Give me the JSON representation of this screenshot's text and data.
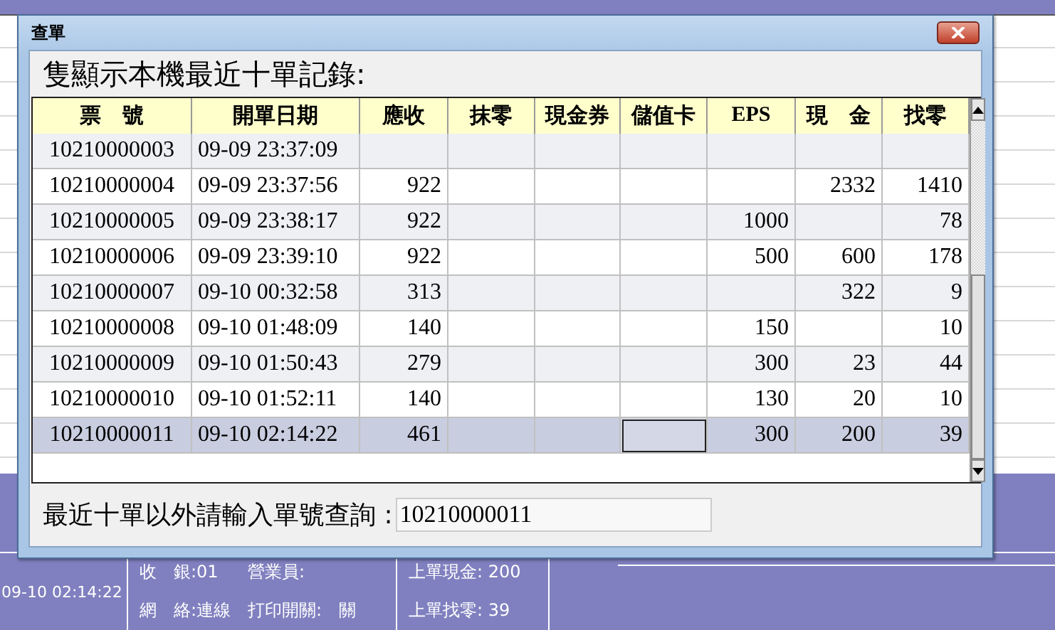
{
  "window": {
    "title": "查單"
  },
  "heading": "隻顯示本機最近十單記錄:",
  "table": {
    "columns": [
      "票　號",
      "開單日期",
      "應收",
      "抹零",
      "現金券",
      "儲值卡",
      "EPS",
      "現　金",
      "找零"
    ],
    "rows": [
      {
        "selected": false,
        "cells": [
          "10210000003",
          "09-09 23:37:09",
          null,
          null,
          null,
          null,
          null,
          null,
          null
        ],
        "focused": [
          false,
          false,
          false,
          false,
          false,
          false,
          false,
          false,
          false
        ]
      },
      {
        "selected": false,
        "cells": [
          "10210000004",
          "09-09 23:37:56",
          "922",
          null,
          null,
          null,
          null,
          "2332",
          "1410"
        ],
        "focused": [
          false,
          false,
          false,
          false,
          false,
          false,
          false,
          false,
          false
        ]
      },
      {
        "selected": false,
        "cells": [
          "10210000005",
          "09-09 23:38:17",
          "922",
          null,
          null,
          null,
          "1000",
          null,
          "78"
        ],
        "focused": [
          false,
          false,
          false,
          false,
          false,
          false,
          false,
          false,
          false
        ]
      },
      {
        "selected": false,
        "cells": [
          "10210000006",
          "09-09 23:39:10",
          "922",
          null,
          null,
          null,
          "500",
          "600",
          "178"
        ],
        "focused": [
          false,
          false,
          false,
          false,
          false,
          false,
          false,
          false,
          false
        ]
      },
      {
        "selected": false,
        "cells": [
          "10210000007",
          "09-10 00:32:58",
          "313",
          null,
          null,
          null,
          null,
          "322",
          "9"
        ],
        "focused": [
          false,
          false,
          false,
          false,
          false,
          false,
          false,
          false,
          false
        ]
      },
      {
        "selected": false,
        "cells": [
          "10210000008",
          "09-10 01:48:09",
          "140",
          null,
          null,
          null,
          "150",
          null,
          "10"
        ],
        "focused": [
          false,
          false,
          false,
          false,
          false,
          false,
          false,
          false,
          false
        ]
      },
      {
        "selected": false,
        "cells": [
          "10210000009",
          "09-10 01:50:43",
          "279",
          null,
          null,
          null,
          "300",
          "23",
          "44"
        ],
        "focused": [
          false,
          false,
          false,
          false,
          false,
          false,
          false,
          false,
          false
        ]
      },
      {
        "selected": false,
        "cells": [
          "10210000010",
          "09-10 01:52:11",
          "140",
          null,
          null,
          null,
          "130",
          "20",
          "10"
        ],
        "focused": [
          false,
          false,
          false,
          false,
          false,
          false,
          false,
          false,
          false
        ]
      },
      {
        "selected": true,
        "cells": [
          "10210000011",
          "09-10 02:14:22",
          "461",
          null,
          null,
          null,
          "300",
          "200",
          "39"
        ],
        "focused": [
          false,
          false,
          false,
          false,
          false,
          true,
          false,
          false,
          false
        ]
      }
    ]
  },
  "search": {
    "label": "最近十單以外請輸入單號查詢 :",
    "value": "10210000011"
  },
  "background": {
    "status_bar": [
      {
        "lines": [
          "09-10 02:14:22"
        ]
      },
      {
        "lines": [
          "收　銀:01",
          "網　絡:連線"
        ]
      },
      {
        "lines": [
          "營業員:",
          "打印開關:　關"
        ]
      },
      {
        "lines": [
          "上單現金: 200",
          "上單找零: 39"
        ]
      }
    ]
  }
}
